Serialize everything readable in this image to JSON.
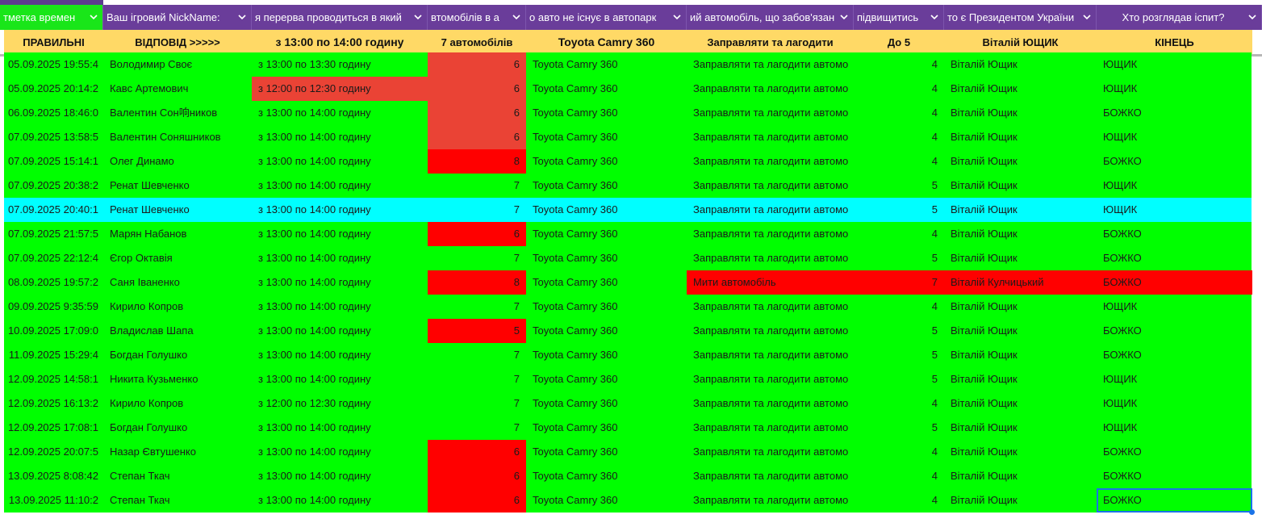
{
  "colors": {
    "header_bg": "#6a3d9a",
    "first_header_bg": "#19e619",
    "answers_bg": "#ffd966",
    "row_green": "#00ff00",
    "row_cyan": "#00ffff",
    "cell_red": "#ff0000",
    "cell_soft_red": "#ea4335",
    "selection": "#1a73e8"
  },
  "headers": [
    {
      "label": "тметка времен",
      "icon": "chevron-down-icon"
    },
    {
      "label": "Ваш ігровий NickName:",
      "icon": "chevron-down-icon"
    },
    {
      "label": "я перерва проводиться в який",
      "icon": "chevron-down-icon"
    },
    {
      "label": "втомобілів в а",
      "icon": "chevron-down-icon"
    },
    {
      "label": "о авто не існує в автопарк",
      "icon": "chevron-down-icon"
    },
    {
      "label": "ий автомобіль, що забов'язан",
      "icon": "chevron-down-icon"
    },
    {
      "label": "підвищитись",
      "icon": "chevron-down-icon"
    },
    {
      "label": "то є Президентом України",
      "icon": "chevron-down-icon"
    },
    {
      "label": "Хто розглядав іспит?",
      "icon": "chevron-down-icon"
    }
  ],
  "answers": [
    "ПРАВИЛЬНІ",
    "ВІДПОВІД >>>>>",
    "з 13:00 по 14:00 годину",
    "7 автомобілів",
    "Toyota Camry 360",
    "Заправляти та лагодити",
    "До 5",
    "Віталій ЮЩИК",
    "КІНЕЦЬ"
  ],
  "rows": [
    {
      "ts": "05.09.2025 19:55:4",
      "nick": "Володимир Своє",
      "break": "з 13:00 по 13:30 годину",
      "count": "6",
      "car": "Toyota Camry 360",
      "duty": "Заправляти та лагодити автомо",
      "level": "4",
      "president": "Віталій Ющик",
      "examiner": "ЮЩИК",
      "bg": "green",
      "break_bg": "",
      "count_bg": "soft",
      "duty_bg": ""
    },
    {
      "ts": "05.09.2025 20:14:2",
      "nick": "Кавс Артемович",
      "break": "з 12:00 по 12:30 годину",
      "count": "6",
      "car": "Toyota Camry 360",
      "duty": "Заправляти та лагодити автомо",
      "level": "4",
      "president": "Віталій Ющик",
      "examiner": "ЮЩИК",
      "bg": "green",
      "break_bg": "soft",
      "count_bg": "soft",
      "duty_bg": ""
    },
    {
      "ts": "06.09.2025 18:46:0",
      "nick": "Валентин Сон响ников",
      "break": "з 13:00 по 14:00 годину",
      "count": "6",
      "car": "Toyota Camry 360",
      "duty": "Заправляти та лагодити автомо",
      "level": "4",
      "president": "Віталій Ющик",
      "examiner": "БОЖКО",
      "bg": "green",
      "break_bg": "",
      "count_bg": "soft",
      "duty_bg": ""
    },
    {
      "ts": "07.09.2025 13:58:5",
      "nick": "Валентин Соняшников",
      "break": "з 13:00 по 14:00 годину",
      "count": "6",
      "car": "Toyota Camry 360",
      "duty": "Заправляти та лагодити автомо",
      "level": "4",
      "president": "Віталій Ющик",
      "examiner": "ЮЩИК",
      "bg": "green",
      "break_bg": "",
      "count_bg": "soft",
      "duty_bg": ""
    },
    {
      "ts": "07.09.2025 15:14:1",
      "nick": "Олег Динамо",
      "break": "з 13:00 по 14:00 годину",
      "count": "8",
      "car": "Toyota Camry 360",
      "duty": "Заправляти та лагодити автомо",
      "level": "4",
      "president": "Віталій Ющик",
      "examiner": "БОЖКО",
      "bg": "green",
      "break_bg": "",
      "count_bg": "red",
      "duty_bg": ""
    },
    {
      "ts": "07.09.2025 20:38:2",
      "nick": "Ренат Шевченко",
      "break": "з 13:00 по 14:00 годину",
      "count": "7",
      "car": "Toyota Camry 360",
      "duty": "Заправляти та лагодити автомо",
      "level": "5",
      "president": "Віталій Ющик",
      "examiner": "ЮЩИК",
      "bg": "green",
      "break_bg": "",
      "count_bg": "",
      "duty_bg": ""
    },
    {
      "ts": "07.09.2025 20:40:1",
      "nick": "Ренат Шевченко",
      "break": "з 13:00 по 14:00 годину",
      "count": "7",
      "car": "Toyota Camry 360",
      "duty": "Заправляти та лагодити автомо",
      "level": "5",
      "president": "Віталій Ющик",
      "examiner": "ЮЩИК",
      "bg": "cyan",
      "break_bg": "",
      "count_bg": "",
      "duty_bg": ""
    },
    {
      "ts": "07.09.2025 21:57:5",
      "nick": "Марян Набанов",
      "break": "з 13:00 по 14:00 годину",
      "count": "6",
      "car": "Toyota Camry 360",
      "duty": "Заправляти та лагодити автомо",
      "level": "4",
      "president": "Віталій Ющик",
      "examiner": "БОЖКО",
      "bg": "green",
      "break_bg": "",
      "count_bg": "red",
      "duty_bg": ""
    },
    {
      "ts": "07.09.2025 22:12:4",
      "nick": "Єгор Октавія",
      "break": "з 13:00 по 14:00 годину",
      "count": "7",
      "car": "Toyota Camry 360",
      "duty": "Заправляти та лагодити автомо",
      "level": "5",
      "president": "Віталій Ющик",
      "examiner": "БОЖКО",
      "bg": "green",
      "break_bg": "",
      "count_bg": "",
      "duty_bg": ""
    },
    {
      "ts": "08.09.2025 19:57:2",
      "nick": "Саня Іваненко",
      "break": "з 13:00 по 14:00 годину",
      "count": "8",
      "car": "Toyota Camry 360",
      "duty": "Мити автомобіль",
      "level": "7",
      "president": "Віталій Кулчицький",
      "examiner": "БОЖКО",
      "bg": "green",
      "break_bg": "",
      "count_bg": "red",
      "duty_bg": "red"
    },
    {
      "ts": "09.09.2025 9:35:59",
      "nick": "Кирило Копров",
      "break": "з 13:00 по 14:00 годину",
      "count": "7",
      "car": "Toyota Camry 360",
      "duty": "Заправляти та лагодити автомо",
      "level": "4",
      "president": "Віталій Ющик",
      "examiner": "ЮЩИК",
      "bg": "green",
      "break_bg": "",
      "count_bg": "",
      "duty_bg": ""
    },
    {
      "ts": "10.09.2025 17:09:0",
      "nick": "Владислав Шапа",
      "break": "з 13:00 по 14:00 годину",
      "count": "5",
      "car": "Toyota Camry 360",
      "duty": "Заправляти та лагодити автомо",
      "level": "5",
      "president": "Віталій Ющик",
      "examiner": "БОЖКО",
      "bg": "green",
      "break_bg": "",
      "count_bg": "red",
      "duty_bg": ""
    },
    {
      "ts": "11.09.2025 15:29:4",
      "nick": "Богдан Голушко",
      "break": "з 13:00 по 14:00 годину",
      "count": "7",
      "car": "Toyota Camry 360",
      "duty": "Заправляти та лагодити автомо",
      "level": "5",
      "president": "Віталій Ющик",
      "examiner": "БОЖКО",
      "bg": "green",
      "break_bg": "",
      "count_bg": "",
      "duty_bg": ""
    },
    {
      "ts": "12.09.2025 14:58:1",
      "nick": "Никита Кузьменко",
      "break": "з 13:00 по 14:00 годину",
      "count": "7",
      "car": "Toyota Camry 360",
      "duty": "Заправляти та лагодити автомо",
      "level": "5",
      "president": "Віталій Ющик",
      "examiner": "ЮЩИК",
      "bg": "green",
      "break_bg": "",
      "count_bg": "",
      "duty_bg": ""
    },
    {
      "ts": "12.09.2025 16:13:2",
      "nick": "Кирило Копров",
      "break": "з 12:00 по 12:30 годину",
      "count": "7",
      "car": "Toyota Camry 360",
      "duty": "Заправляти та лагодити автомо",
      "level": "4",
      "president": "Віталій Ющик",
      "examiner": "ЮЩИК",
      "bg": "green",
      "break_bg": "",
      "count_bg": "",
      "duty_bg": ""
    },
    {
      "ts": "12.09.2025 17:08:1",
      "nick": "Богдан Голушко",
      "break": "з 13:00 по 14:00 годину",
      "count": "7",
      "car": "Toyota Camry 360",
      "duty": "Заправляти та лагодити автомо",
      "level": "5",
      "president": "Віталій Ющик",
      "examiner": "ЮЩИК",
      "bg": "green",
      "break_bg": "",
      "count_bg": "",
      "duty_bg": ""
    },
    {
      "ts": "12.09.2025 20:07:5",
      "nick": "Назар Євтушенко",
      "break": "з 13:00 по 14:00 годину",
      "count": "6",
      "car": "Toyota Camry 360",
      "duty": "Заправляти та лагодити автомо",
      "level": "4",
      "president": "Віталій Ющик",
      "examiner": "БОЖКО",
      "bg": "green",
      "break_bg": "",
      "count_bg": "red",
      "duty_bg": ""
    },
    {
      "ts": "13.09.2025 8:08:42",
      "nick": "Степан Ткач",
      "break": "з 13:00 по 14:00 годину",
      "count": "6",
      "car": "Toyota Camry 360",
      "duty": "Заправляти та лагодити автомо",
      "level": "4",
      "president": "Віталій Ющик",
      "examiner": "БОЖКО",
      "bg": "green",
      "break_bg": "",
      "count_bg": "red",
      "duty_bg": ""
    },
    {
      "ts": "13.09.2025 11:10:2",
      "nick": "Степан Ткач",
      "break": "з 13:00 по 14:00 годину",
      "count": "6",
      "car": "Toyota Camry 360",
      "duty": "Заправляти та лагодити автомо",
      "level": "4",
      "president": "Віталій Ющик",
      "examiner": "БОЖКО",
      "bg": "green",
      "break_bg": "",
      "count_bg": "red",
      "duty_bg": ""
    }
  ]
}
